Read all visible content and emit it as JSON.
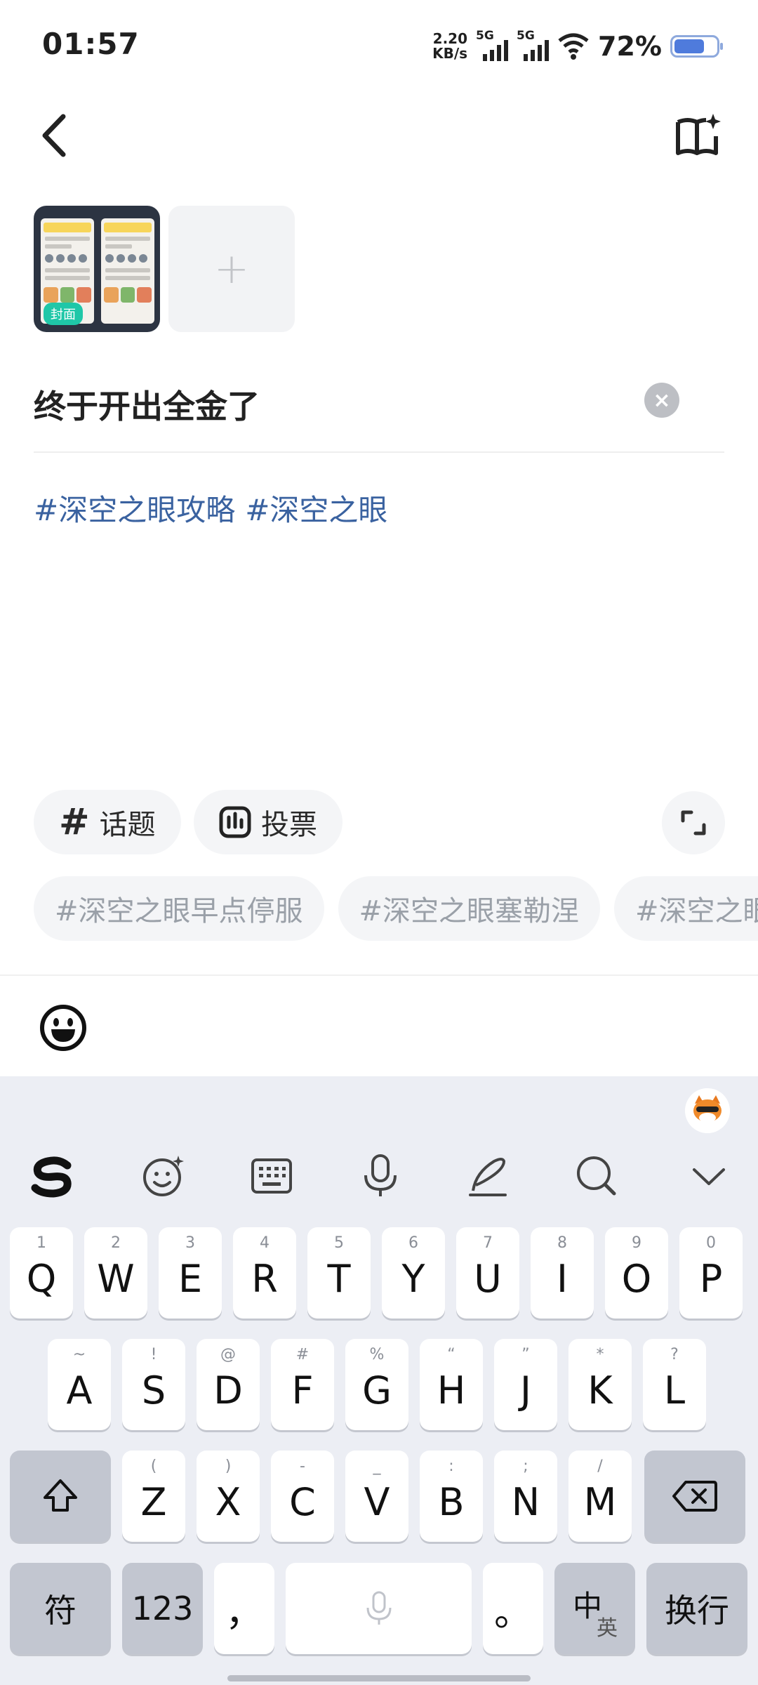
{
  "status_bar": {
    "time": "01:57",
    "net_speed_value": "2.20",
    "net_speed_unit": "KB/s",
    "sim1_tag": "5G",
    "sim2_tag": "5G",
    "battery_percent": "72%",
    "battery_level": 0.72
  },
  "images": {
    "cover_label": "封面",
    "add_symbol": "+"
  },
  "post": {
    "title": "终于开出全金了",
    "hashtags": [
      "#深空之眼攻略",
      "#深空之眼"
    ]
  },
  "tools": {
    "topic_label": "话题",
    "topic_symbol": "#",
    "vote_label": "投票"
  },
  "suggested_topics": [
    "#深空之眼早点停服",
    "#深空之眼塞勒涅",
    "#深空之眼"
  ],
  "keyboard": {
    "row1": [
      {
        "main": "Q",
        "sub": "1"
      },
      {
        "main": "W",
        "sub": "2"
      },
      {
        "main": "E",
        "sub": "3"
      },
      {
        "main": "R",
        "sub": "4"
      },
      {
        "main": "T",
        "sub": "5"
      },
      {
        "main": "Y",
        "sub": "6"
      },
      {
        "main": "U",
        "sub": "7"
      },
      {
        "main": "I",
        "sub": "8"
      },
      {
        "main": "O",
        "sub": "9"
      },
      {
        "main": "P",
        "sub": "0"
      }
    ],
    "row2": [
      {
        "main": "A",
        "sub": "~"
      },
      {
        "main": "S",
        "sub": "!"
      },
      {
        "main": "D",
        "sub": "@"
      },
      {
        "main": "F",
        "sub": "#"
      },
      {
        "main": "G",
        "sub": "%"
      },
      {
        "main": "H",
        "sub": "“"
      },
      {
        "main": "J",
        "sub": "”"
      },
      {
        "main": "K",
        "sub": "*"
      },
      {
        "main": "L",
        "sub": "?"
      }
    ],
    "row3": [
      {
        "main": "Z",
        "sub": "("
      },
      {
        "main": "X",
        "sub": ")"
      },
      {
        "main": "C",
        "sub": "-"
      },
      {
        "main": "V",
        "sub": "_"
      },
      {
        "main": "B",
        "sub": ":"
      },
      {
        "main": "N",
        "sub": ";"
      },
      {
        "main": "M",
        "sub": "/"
      }
    ],
    "symbols_key": "符",
    "numbers_key": "123",
    "comma_key": "，",
    "period_key": "。",
    "lang_key_main": "中",
    "lang_key_sub": "英",
    "enter_key": "换行"
  }
}
